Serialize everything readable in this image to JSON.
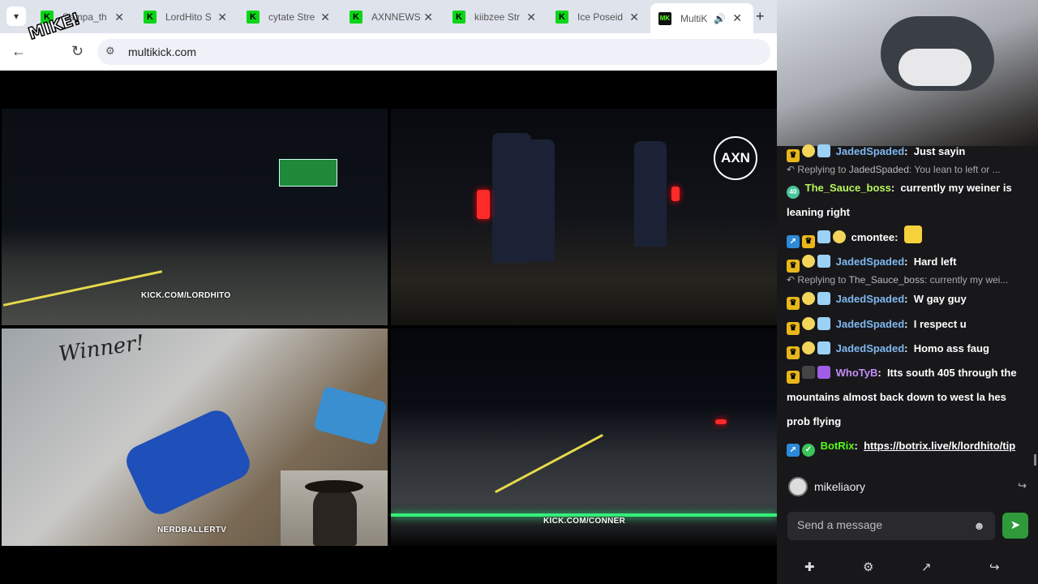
{
  "browser": {
    "tabs": [
      {
        "title": "Sampa_th",
        "favicon": "K"
      },
      {
        "title": "LordHito S",
        "favicon": "K"
      },
      {
        "title": "cytate Stre",
        "favicon": "K"
      },
      {
        "title": "AXNNEWS",
        "favicon": "K"
      },
      {
        "title": "kiibzee Str",
        "favicon": "K"
      },
      {
        "title": "Ice Poseid",
        "favicon": "K"
      },
      {
        "title": "MultiK",
        "favicon": "MK"
      }
    ],
    "url": "multikick.com",
    "logo_text": "MIKE!"
  },
  "streams": [
    {
      "watermark": "KICK.COM/LORDHITO"
    },
    {
      "watermark": "AXN"
    },
    {
      "watermark": "NERDBALLERTV",
      "graffiti": "Winner!"
    },
    {
      "watermark": "KICK.COM/CONNER"
    }
  ],
  "chat": {
    "messages": [
      {
        "user": "JadedSpaded",
        "text": "Just sayin"
      },
      {
        "reply_prefix": "Replying to",
        "reply_user": "JadedSpaded",
        "reply_text": ": You lean to left or ..."
      },
      {
        "user": "The_Sauce_boss",
        "text": "currently my weiner is",
        "text2": "leaning right"
      },
      {
        "user": "cmontee",
        "text": ""
      },
      {
        "user": "JadedSpaded",
        "text": "Hard left"
      },
      {
        "reply_prefix": "Replying to",
        "reply_user": "The_Sauce_boss",
        "reply_text": ": currently my wei..."
      },
      {
        "user": "JadedSpaded",
        "text": "W gay guy"
      },
      {
        "user": "JadedSpaded",
        "text": "I respect u"
      },
      {
        "user": "JadedSpaded",
        "text": "Homo ass faug"
      },
      {
        "user": "WhoTyB",
        "text": "Itts south 405 through the",
        "text2": "mountains almost back down to west la hes",
        "text3": "prob flying"
      },
      {
        "user": "BotRix",
        "text": "https://botrix.live/k/lordhito/tip"
      }
    ],
    "user_colors": {
      "JadedSpaded": "#7fb8f0",
      "The_Sauce_boss": "#b7f55a",
      "cmontee": "#ffffff",
      "WhoTyB": "#c28ff7",
      "BotRix": "#53fc18"
    },
    "current_user": "mikeliaory",
    "input_placeholder": "Send a message"
  }
}
